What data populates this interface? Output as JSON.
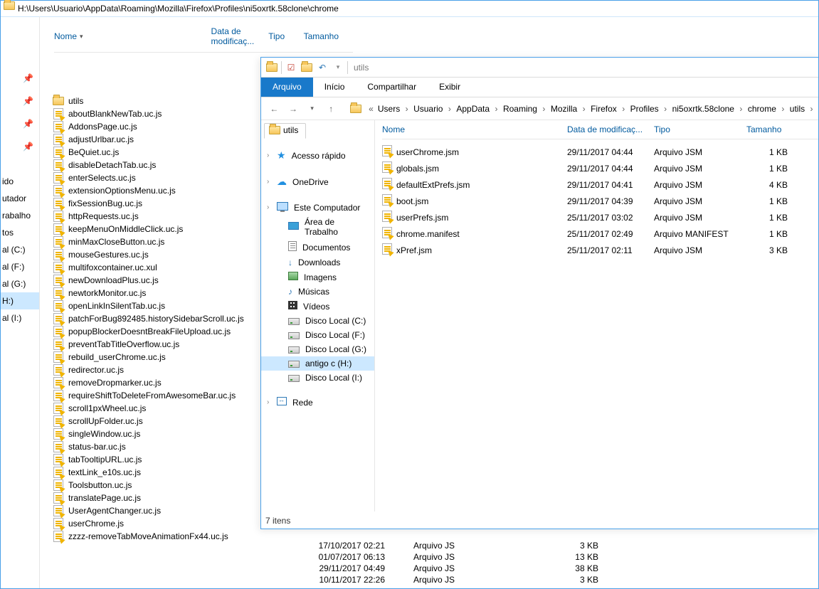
{
  "back": {
    "address": "H:\\Users\\Usuario\\AppData\\Roaming\\Mozilla\\Firefox\\Profiles\\ni5oxrtk.58clone\\chrome",
    "headers": {
      "name": "Nome",
      "date": "Data de modificaç...",
      "type": "Tipo",
      "size": "Tamanho"
    },
    "sidebar_frags": [
      "ido",
      "utador",
      "rabalho",
      "tos",
      "al (C:)",
      "al (F:)",
      "al (G:)",
      "H:)",
      "al (I:)"
    ],
    "files": [
      {
        "name": "utils",
        "folder": true
      },
      {
        "name": "aboutBlankNewTab.uc.js"
      },
      {
        "name": "AddonsPage.uc.js"
      },
      {
        "name": "adjustUrlbar.uc.js"
      },
      {
        "name": "BeQuiet.uc.js"
      },
      {
        "name": "disableDetachTab.uc.js"
      },
      {
        "name": "enterSelects.uc.js"
      },
      {
        "name": "extensionOptionsMenu.uc.js"
      },
      {
        "name": "fixSessionBug.uc.js"
      },
      {
        "name": "httpRequests.uc.js"
      },
      {
        "name": "keepMenuOnMiddleClick.uc.js"
      },
      {
        "name": "minMaxCloseButton.uc.js"
      },
      {
        "name": "mouseGestures.uc.js"
      },
      {
        "name": "multifoxcontainer.uc.xul"
      },
      {
        "name": "newDownloadPlus.uc.js"
      },
      {
        "name": "newtorkMonitor.uc.js"
      },
      {
        "name": "openLinkInSilentTab.uc.js"
      },
      {
        "name": "patchForBug892485.historySidebarScroll.uc.js"
      },
      {
        "name": "popupBlockerDoesntBreakFileUpload.uc.js"
      },
      {
        "name": "preventTabTitleOverflow.uc.js"
      },
      {
        "name": "rebuild_userChrome.uc.js"
      },
      {
        "name": "redirector.uc.js"
      },
      {
        "name": "removeDropmarker.uc.js"
      },
      {
        "name": "requireShiftToDeleteFromAwesomeBar.uc.js"
      },
      {
        "name": "scroll1pxWheel.uc.js"
      },
      {
        "name": "scrollUpFolder.uc.js"
      },
      {
        "name": "singleWindow.uc.js"
      },
      {
        "name": "status-bar.uc.js"
      },
      {
        "name": "tabTooltipURL.uc.js"
      },
      {
        "name": "textLink_e10s.uc.js"
      },
      {
        "name": "Toolsbutton.uc.js"
      },
      {
        "name": "translatePage.uc.js"
      },
      {
        "name": "UserAgentChanger.uc.js"
      },
      {
        "name": "userChrome.js"
      },
      {
        "name": "zzzz-removeTabMoveAnimationFx44.uc.js"
      }
    ],
    "bottom_rows": [
      {
        "date": "17/10/2017 02:21",
        "type": "Arquivo JS",
        "size": "3 KB"
      },
      {
        "date": "01/07/2017 06:13",
        "type": "Arquivo JS",
        "size": "13 KB"
      },
      {
        "date": "29/11/2017 04:49",
        "type": "Arquivo JS",
        "size": "38 KB"
      },
      {
        "date": "10/11/2017 22:26",
        "type": "Arquivo JS",
        "size": "3 KB"
      }
    ]
  },
  "front": {
    "title": "utils",
    "tabs": {
      "arquivo": "Arquivo",
      "inicio": "Início",
      "compartilhar": "Compartilhar",
      "exibir": "Exibir"
    },
    "breadcrumbs": [
      "Users",
      "Usuario",
      "AppData",
      "Roaming",
      "Mozilla",
      "Firefox",
      "Profiles",
      "ni5oxrtk.58clone",
      "chrome",
      "utils"
    ],
    "folder_tab": "utils",
    "tree": [
      {
        "icon": "star",
        "label": "Acesso rápido",
        "caret": true
      },
      {
        "spacer": true
      },
      {
        "icon": "cloud",
        "label": "OneDrive",
        "caret": true
      },
      {
        "spacer": true
      },
      {
        "icon": "pc",
        "label": "Este Computador",
        "caret": true
      },
      {
        "icon": "desktop",
        "label": "Área de Trabalho",
        "l2": true
      },
      {
        "icon": "docs",
        "label": "Documentos",
        "l2": true
      },
      {
        "icon": "dl",
        "label": "Downloads",
        "l2": true
      },
      {
        "icon": "img",
        "label": "Imagens",
        "l2": true
      },
      {
        "icon": "music",
        "label": "Músicas",
        "l2": true
      },
      {
        "icon": "video",
        "label": "Vídeos",
        "l2": true
      },
      {
        "icon": "drive",
        "label": "Disco Local (C:)",
        "l2": true
      },
      {
        "icon": "drive",
        "label": "Disco Local (F:)",
        "l2": true
      },
      {
        "icon": "drive",
        "label": "Disco Local (G:)",
        "l2": true
      },
      {
        "icon": "drive",
        "label": "antigo c (H:)",
        "l2": true,
        "sel": true
      },
      {
        "icon": "drive",
        "label": "Disco Local (I:)",
        "l2": true
      },
      {
        "spacer": true
      },
      {
        "icon": "net",
        "label": "Rede",
        "caret": true
      }
    ],
    "headers": {
      "name": "Nome",
      "date": "Data de modificaç...",
      "type": "Tipo",
      "size": "Tamanho"
    },
    "rows": [
      {
        "name": "userChrome.jsm",
        "date": "29/11/2017 04:44",
        "type": "Arquivo JSM",
        "size": "1 KB"
      },
      {
        "name": "globals.jsm",
        "date": "29/11/2017 04:44",
        "type": "Arquivo JSM",
        "size": "1 KB"
      },
      {
        "name": "defaultExtPrefs.jsm",
        "date": "29/11/2017 04:41",
        "type": "Arquivo JSM",
        "size": "4 KB"
      },
      {
        "name": "boot.jsm",
        "date": "29/11/2017 04:39",
        "type": "Arquivo JSM",
        "size": "1 KB"
      },
      {
        "name": "userPrefs.jsm",
        "date": "25/11/2017 03:02",
        "type": "Arquivo JSM",
        "size": "1 KB"
      },
      {
        "name": "chrome.manifest",
        "date": "25/11/2017 02:49",
        "type": "Arquivo MANIFEST",
        "size": "1 KB"
      },
      {
        "name": "xPref.jsm",
        "date": "25/11/2017 02:11",
        "type": "Arquivo JSM",
        "size": "3 KB"
      }
    ],
    "status": "7 itens"
  }
}
